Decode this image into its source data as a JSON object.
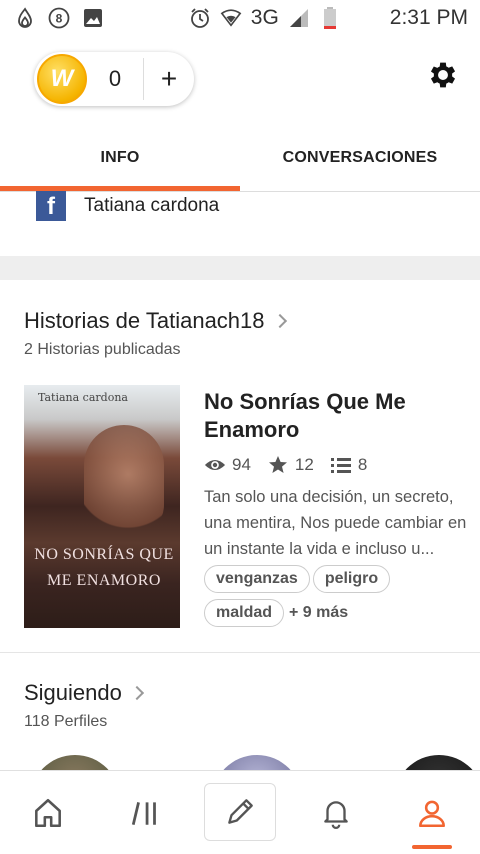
{
  "status_bar": {
    "left_icons": [
      "flame-icon",
      "notification-8-icon",
      "image-icon"
    ],
    "right_icons": [
      "alarm-icon",
      "wifi-icon",
      "signal-icon",
      "battery-icon"
    ],
    "network": "3G",
    "time": "2:31 PM"
  },
  "topbar": {
    "coin_count": "0",
    "coin_symbol": "W",
    "add_symbol": "+"
  },
  "tabs": [
    {
      "label": "INFO",
      "active": true
    },
    {
      "label": "CONVERSACIONES",
      "active": false
    }
  ],
  "facebook": {
    "letter": "f",
    "name": "Tatiana cardona"
  },
  "stories_section": {
    "title": "Historias de Tatianach18",
    "subtitle": "2 Historias publicadas"
  },
  "story": {
    "cover_author": "Tatiana cardona",
    "cover_title": "NO SONRÍAS QUE ME ENAMORO",
    "title": "No Sonrías Que Me Enamoro",
    "views": "94",
    "votes": "12",
    "parts": "8",
    "description": "Tan solo una decisión, un secreto, una mentira, Nos puede cambiar en un instante la vida e incluso u...",
    "tags": [
      "venganzas",
      "peligro",
      "maldad"
    ],
    "more_tags": "+ 9 más"
  },
  "following_section": {
    "title": "Siguiendo",
    "subtitle": "118 Perfiles"
  },
  "colors": {
    "accent": "#f26531",
    "facebook": "#3b5998",
    "coin": "#f5b400"
  }
}
